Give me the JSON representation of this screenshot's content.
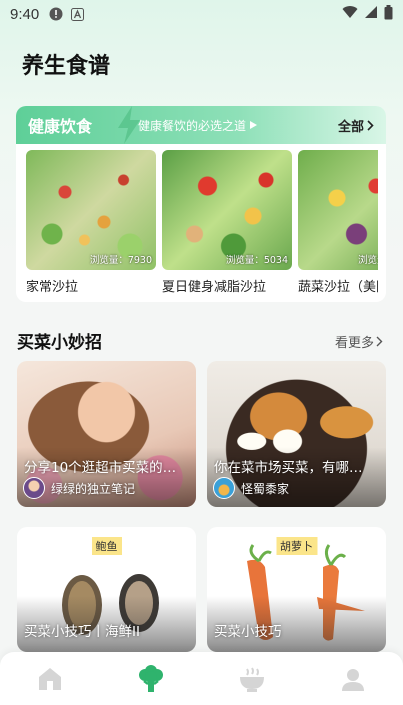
{
  "status_bar": {
    "time": "9:40"
  },
  "page": {
    "title": "养生食谱"
  },
  "healthy": {
    "title": "健康饮食",
    "subtitle": "健康餐饮的必选之道",
    "all_label": "全部",
    "recipes": [
      {
        "name": "家常沙拉",
        "views": "浏览量：7930"
      },
      {
        "name": "夏日健身减脂沙拉",
        "views": "浏览量：5034"
      },
      {
        "name": "蔬菜沙拉（美国",
        "views": "浏览量"
      }
    ]
  },
  "tips": {
    "title": "买菜小妙招",
    "more_label": "看更多",
    "articles": [
      {
        "caption": "分享10个逛超市买菜的…",
        "author": "绿绿的独立笔记"
      },
      {
        "caption": "你在菜市场买菜，有哪…",
        "author": "怪蜀黍家"
      }
    ],
    "ingredients": [
      {
        "tag": "鲍鱼",
        "caption": "买菜小技巧丨海鲜II"
      },
      {
        "tag": "胡萝卜",
        "caption": "买菜小技巧"
      }
    ]
  },
  "tabbar": {
    "items": [
      {
        "icon": "home-icon",
        "active": false
      },
      {
        "icon": "broccoli-icon",
        "active": true
      },
      {
        "icon": "bowl-icon",
        "active": false
      },
      {
        "icon": "profile-icon",
        "active": false
      }
    ]
  },
  "colors": {
    "accent": "#2fb36d",
    "inactive": "#d5d5d5"
  }
}
